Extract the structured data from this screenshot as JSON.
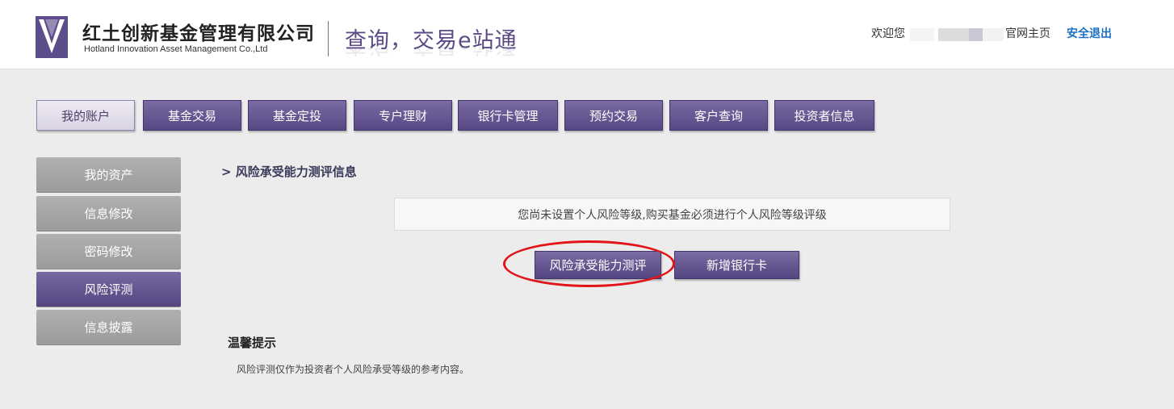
{
  "header": {
    "company_name_cn": "红土创新基金管理有限公司",
    "company_name_en": "Hotland Innovation Asset Management Co.,Ltd",
    "slogan": "查询，交易e站通",
    "welcome_text": "欢迎您",
    "homepage_link": "官网主页",
    "logout_link": "安全退出"
  },
  "topnav": {
    "tabs": [
      {
        "label": "我的账户",
        "active": true
      },
      {
        "label": "基金交易"
      },
      {
        "label": "基金定投"
      },
      {
        "label": "专户理财"
      },
      {
        "label": "银行卡管理"
      },
      {
        "label": "预约交易"
      },
      {
        "label": "客户查询"
      },
      {
        "label": "投资者信息"
      }
    ]
  },
  "sidemenu": {
    "items": [
      {
        "label": "我的资产"
      },
      {
        "label": "信息修改"
      },
      {
        "label": "密码修改"
      },
      {
        "label": "风险评测",
        "active": true
      },
      {
        "label": "信息披露"
      }
    ]
  },
  "main": {
    "section_title": "> 风险承受能力测评信息",
    "notice": "您尚未设置个人风险等级,购买基金必须进行个人风险等级评级",
    "risk_assessment_button": "风险承受能力测评",
    "add_bank_card_button": "新增银行卡",
    "tips_title": "温馨提示",
    "tips_text": "风险评测仅作为投资者个人风险承受等级的参考内容。"
  },
  "colors": {
    "brand_purple": "#574783",
    "link_blue": "#1b70c6",
    "highlight_red": "#e2141a"
  }
}
